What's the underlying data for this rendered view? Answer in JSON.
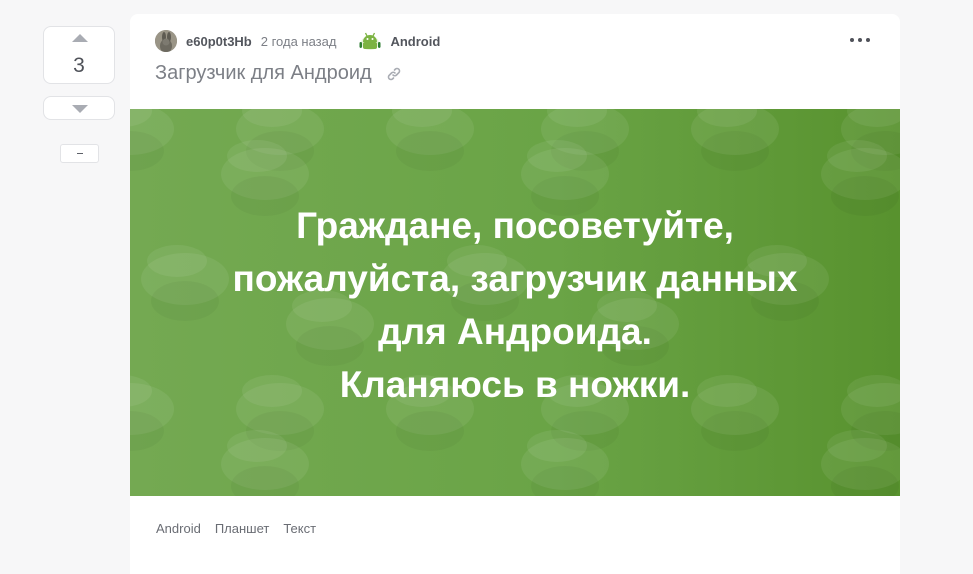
{
  "vote": {
    "count": "3",
    "minus_label": "–"
  },
  "post": {
    "author": "e60p0t3Hb",
    "time": "2 года назад",
    "community": "Android",
    "title": "Загрузчик для Андроид",
    "banner_lines": [
      "Граждане, посоветуйте,",
      "пожалуйста, загрузчик данных",
      "для Андроида.",
      "Кланяюсь в ножки."
    ],
    "banner_color": "#6aa446",
    "tags": [
      "Android",
      "Планшет",
      "Текст"
    ]
  },
  "icons": {
    "upvote": "arrow-up-icon",
    "downvote": "arrow-down-icon",
    "more": "more-dots-icon",
    "link": "link-icon",
    "community": "android-icon"
  }
}
